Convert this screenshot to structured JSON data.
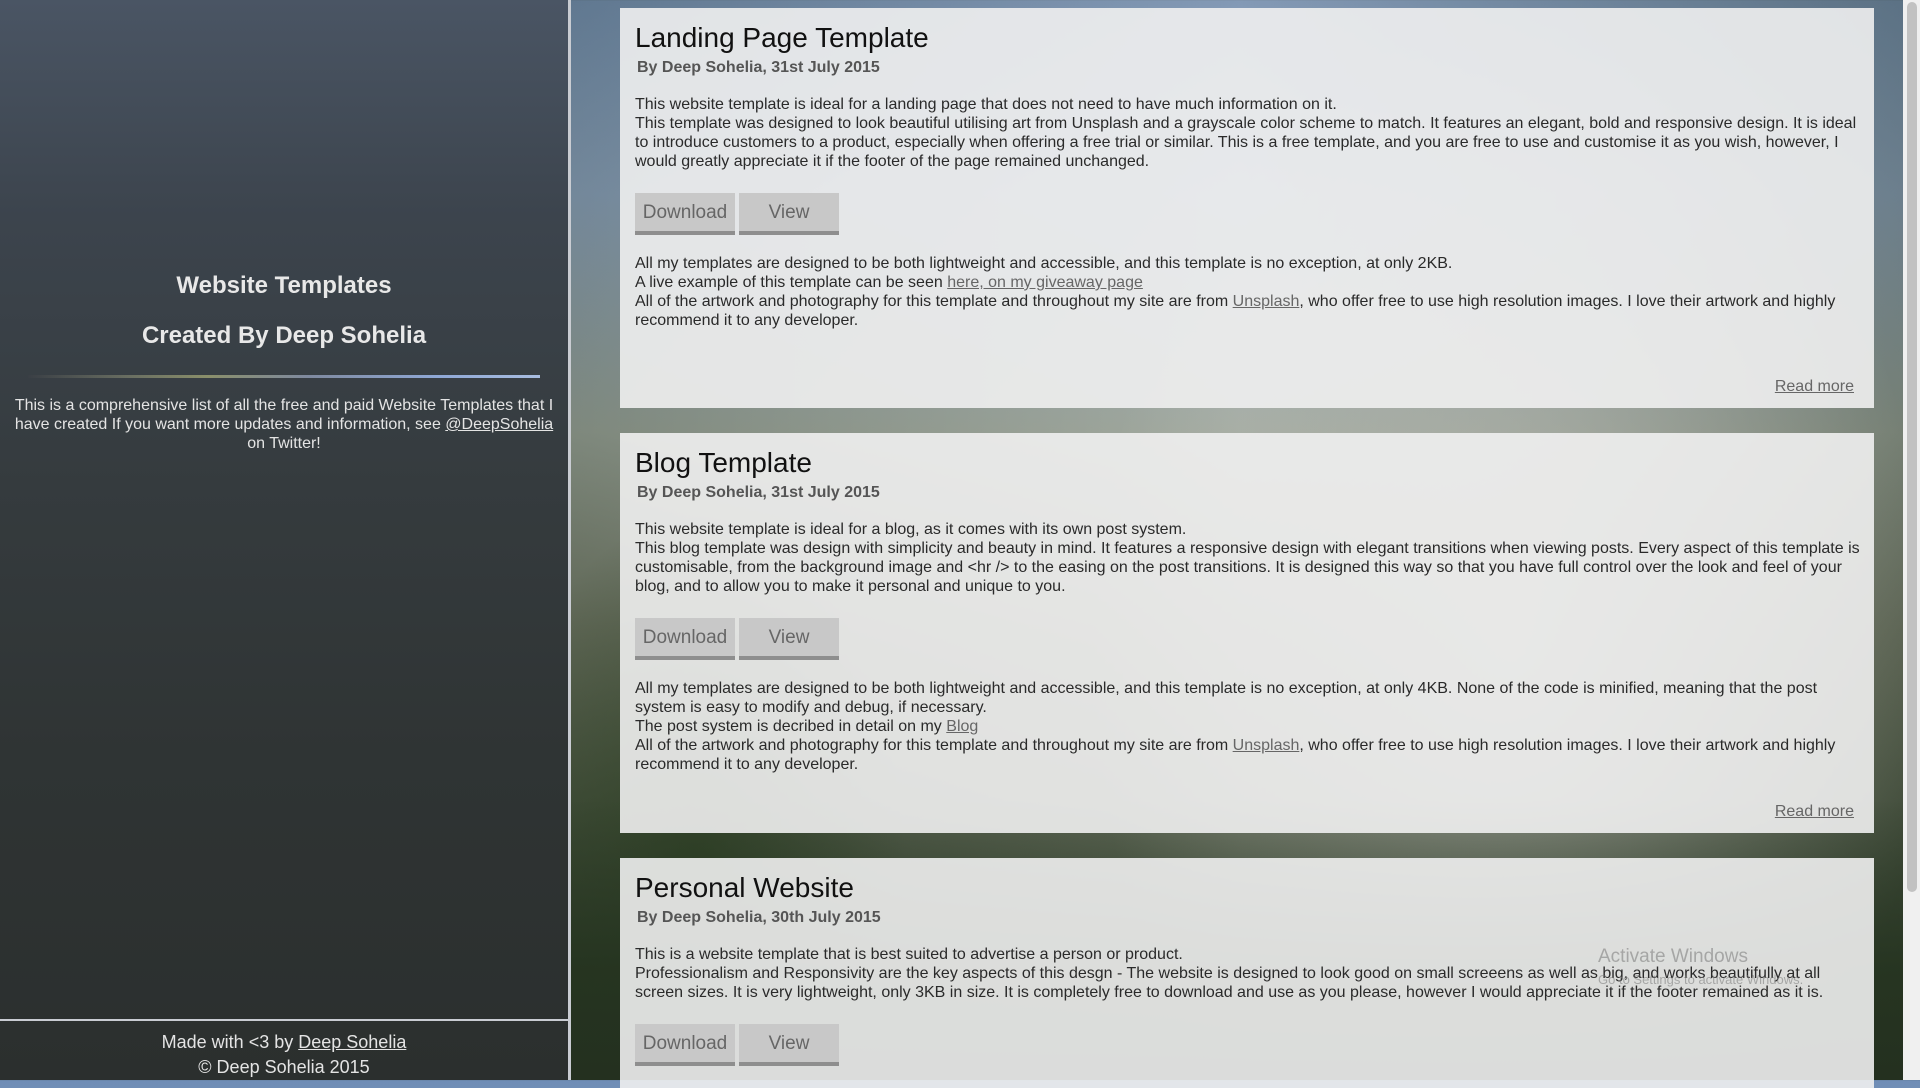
{
  "sidebar": {
    "title": "Website Templates",
    "subtitle": "Created By Deep Sohelia",
    "intro_text": "This is a comprehensive list of all the free and paid Website Templates that I have created If you want more updates and information, see",
    "twitter_link": "@DeepSohelia",
    "intro_tail": "on Twitter!",
    "footer_made": "Made with <3 by",
    "footer_author_link": "Deep Sohelia",
    "footer_copyright": "© Deep Sohelia 2015"
  },
  "cards": [
    {
      "title": "Landing Page Template",
      "byline": "By Deep Sohelia, 31st July 2015",
      "desc1": "This website template is ideal for a landing page that does not need to have much information on it.",
      "desc2": "This template was designed to look beautiful utilising art from Unsplash and a grayscale color scheme to match. It features an elegant, bold and responsive design. It is ideal to introduce customers to a product, especially when offering a free trial or similar. This is a free template, and you are free to use and customise it as you wish, however, I would greatly appreciate it if the footer of the page remained unchanged.",
      "download": "Download",
      "view": "View",
      "extra1": "All my templates are designed to be both lightweight and accessible, and this template is no exception, at only 2KB.",
      "extra2_pre": "A live example of this template can be seen",
      "extra2_link": "here, on my giveaway page",
      "extra3_pre": "All of the artwork and photography for this template and throughout my site are from",
      "extra3_link": "Unsplash",
      "extra3_post": ", who offer free to use high resolution images. I love their artwork and highly recommend it to any developer.",
      "read_more": "Read more"
    },
    {
      "title": "Blog Template",
      "byline": "By Deep Sohelia, 31st July 2015",
      "desc1": "This website template is ideal for a blog, as it comes with its own post system.",
      "desc2": "This blog template was design with simplicity and beauty in mind. It features a responsive design with elegant transitions when viewing posts. Every aspect of this template is customisable, from the background image and <hr /> to the easing on the post transitions. It is designed this way so that you have full control over the look and feel of your blog, and to allow you to make it personal and unique to you.",
      "download": "Download",
      "view": "View",
      "extra1": "All my templates are designed to be both lightweight and accessible, and this template is no exception, at only 4KB. None of the code is minified, meaning that the post system is easy to modify and debug, if necessary.",
      "extra2_pre": "The post system is decribed in detail on my",
      "extra2_link": "Blog",
      "extra3_pre": "All of the artwork and photography for this template and throughout my site are from",
      "extra3_link": "Unsplash",
      "extra3_post": ", who offer free to use high resolution images. I love their artwork and highly recommend it to any developer.",
      "read_more": "Read more"
    },
    {
      "title": "Personal Website",
      "byline": "By Deep Sohelia, 30th July 2015",
      "desc1": "This is a website template that is best suited to advertise a person or product.",
      "desc2": "Professionalism and Responsivity are the key aspects of this desgn - The website is designed to look good on small screeens as well as big, and works beautifully at all screen sizes. It is very lightweight, only 3KB in size. It is completely free to download and use as you please, however I would appreciate it if the footer remained as it is.",
      "download": "Download",
      "view": "View"
    }
  ],
  "watermark": {
    "line1": "Activate Windows",
    "line2": "Go to Settings to activate Windows."
  }
}
